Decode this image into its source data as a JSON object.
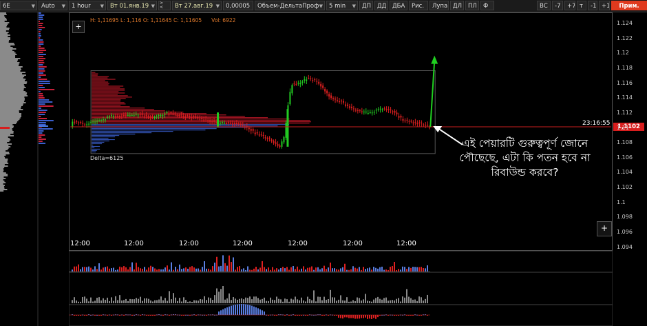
{
  "toolbar": {
    "symbol": "6E",
    "scale_mode": "Auto",
    "timeframe": "1 hour",
    "date_from": "Вт 01.янв.19",
    "date_to": "Вт 27.авг.19",
    "tick_size": "0,00005",
    "profile_type": "Объем-ДельтаПроф",
    "bar_interval": "5 min",
    "tools": [
      "ДП",
      "ДД",
      "ДБА",
      "Рис.",
      "Лупа",
      "ДЛ",
      "ПЛ",
      "Ф"
    ],
    "right_buttons": [
      "ВС",
      "-7",
      "+7",
      "т",
      "-1",
      "+1"
    ],
    "apply_label": "Прим."
  },
  "chart": {
    "ohlc_line": "H: 1,11695  L: 1,116  O: 1,11645  C: 1,11605",
    "vol_label": "Vol: 6922",
    "delta_label": "Delta=6125",
    "clock": "23:16:55",
    "current_price": "1,1102",
    "plus_label": "+",
    "price_ticks": [
      "1.124",
      "1.122",
      "1.12",
      "1.118",
      "1.116",
      "1.114",
      "1.112",
      "1.11",
      "1.108",
      "1.106",
      "1.104",
      "1.102",
      "1.1",
      "1.098",
      "1.096",
      "1.094"
    ],
    "price_range": [
      1.0935,
      1.1255
    ],
    "time_ticks": [
      "12:00",
      "12:00",
      "12:00",
      "12:00",
      "12:00",
      "12:00",
      "12:00"
    ],
    "caption": "এই পেয়ারটি গুরুত্বপূর্ণ জোনে পৌছেছে, এটা কি পতন হবে না রিবাউন্ড করবে?",
    "colors": {
      "up": "#22cc22",
      "down": "#e02020",
      "profile": "#cc1a2a",
      "delta_neg": "#3a5ecc",
      "arrow": "#20d020",
      "accent": "#e03a1e"
    }
  }
}
